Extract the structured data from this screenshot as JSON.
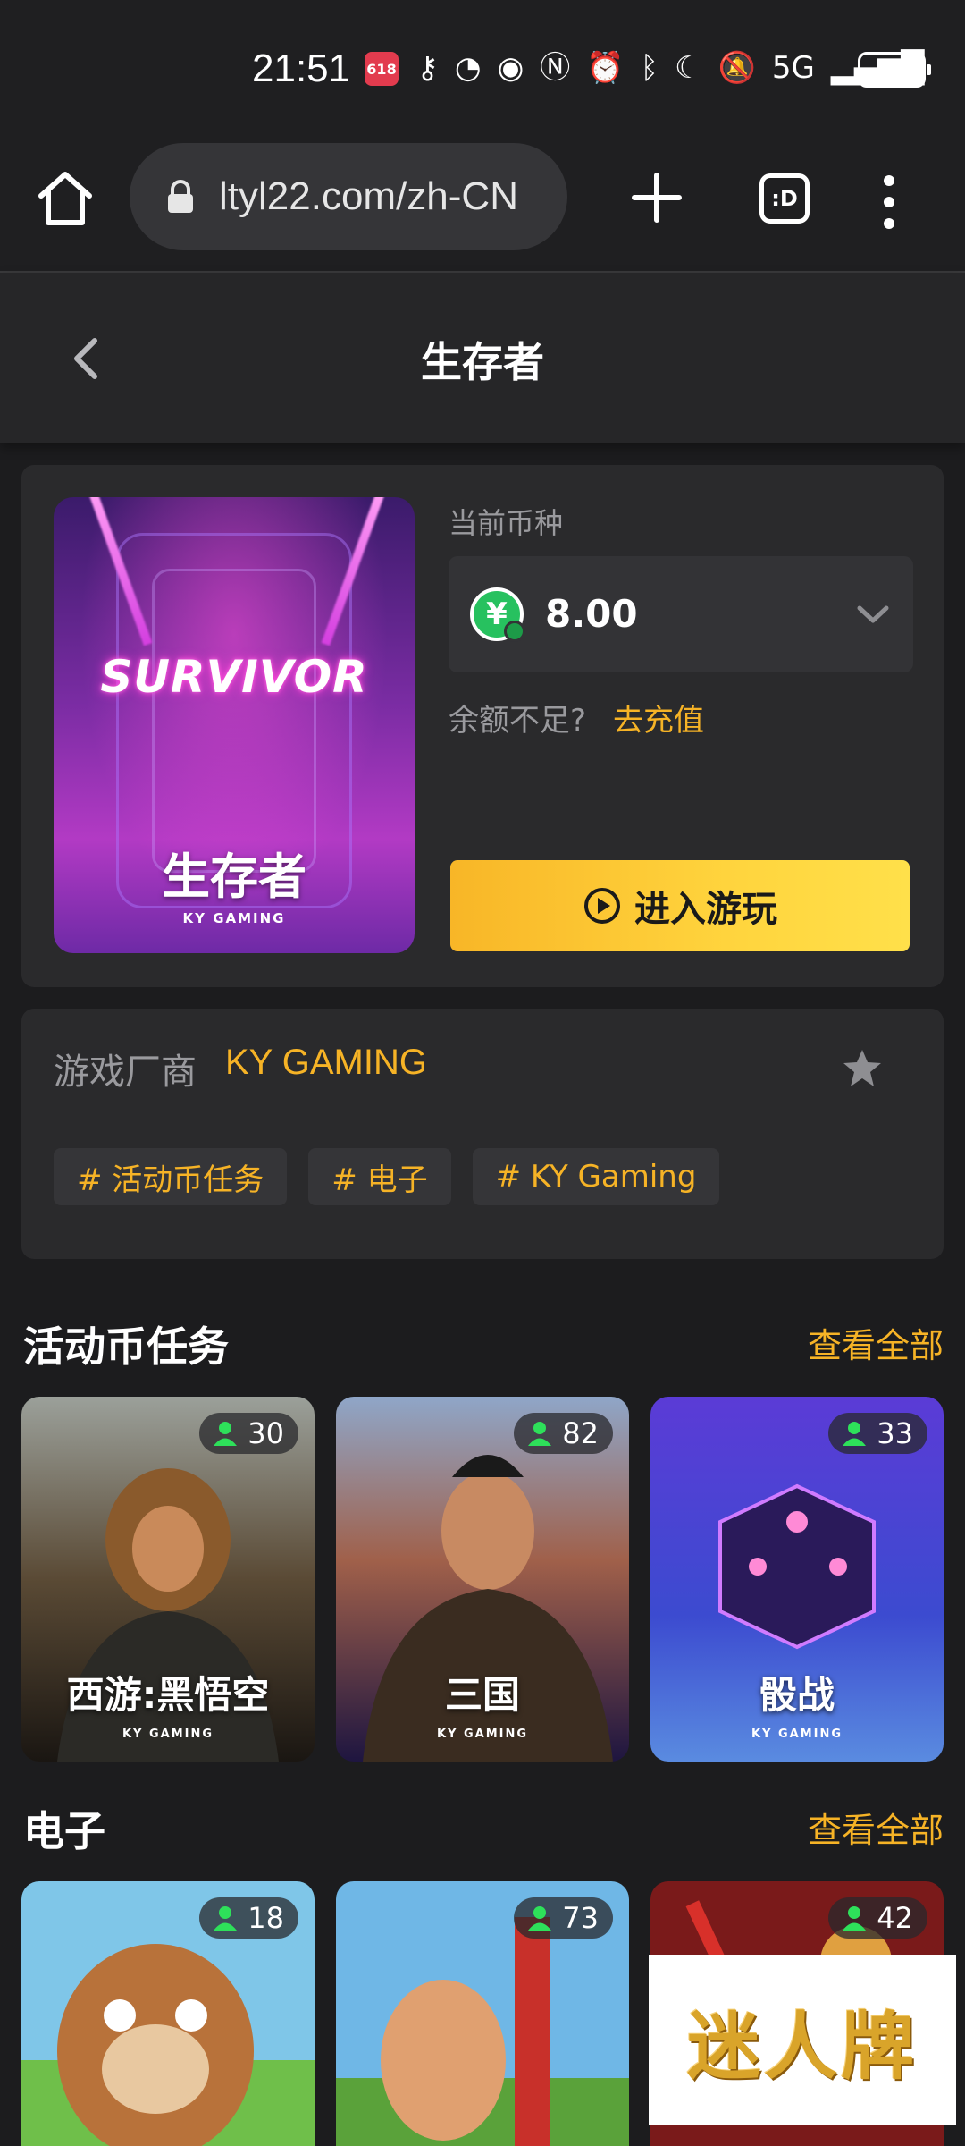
{
  "status_bar": {
    "time": "21:51",
    "app_badge": "618",
    "network": "5G",
    "battery": "26"
  },
  "browser": {
    "url": "ltyl22.com/zh-CN",
    "tabs_icon_text": ":D"
  },
  "header": {
    "title": "生存者"
  },
  "game": {
    "cover_logo": "SURVIVOR",
    "cover_title": "生存者",
    "cover_brand": "KY GAMING",
    "currency_label": "当前币种",
    "currency_symbol": "¥",
    "balance": "8.00",
    "insufficient_text": "余额不足?",
    "recharge_link": "去充值",
    "play_button": "进入游玩"
  },
  "vendor": {
    "label": "游戏厂商",
    "name": "KY GAMING",
    "tags": [
      "# 活动币任务",
      "# 电子",
      "# KY Gaming"
    ]
  },
  "sections": [
    {
      "title": "活动币任务",
      "view_all": "查看全部",
      "games": [
        {
          "name": "西游:黑悟空",
          "brand": "KY GAMING",
          "players": "30"
        },
        {
          "name": "三国",
          "brand": "KY GAMING",
          "players": "82"
        },
        {
          "name": "骰战",
          "brand": "KY GAMING",
          "players": "33"
        }
      ]
    },
    {
      "title": "电子",
      "view_all": "查看全部",
      "games": [
        {
          "name": "",
          "brand": "",
          "players": "18"
        },
        {
          "name": "",
          "brand": "",
          "players": "73"
        },
        {
          "name": "",
          "brand": "",
          "players": "42"
        }
      ]
    }
  ],
  "watermark": "迷人牌",
  "colors": {
    "accent": "#f6b326",
    "background": "#1c1c1e",
    "card": "#2a2a2c",
    "player_icon": "#2ee05a"
  }
}
